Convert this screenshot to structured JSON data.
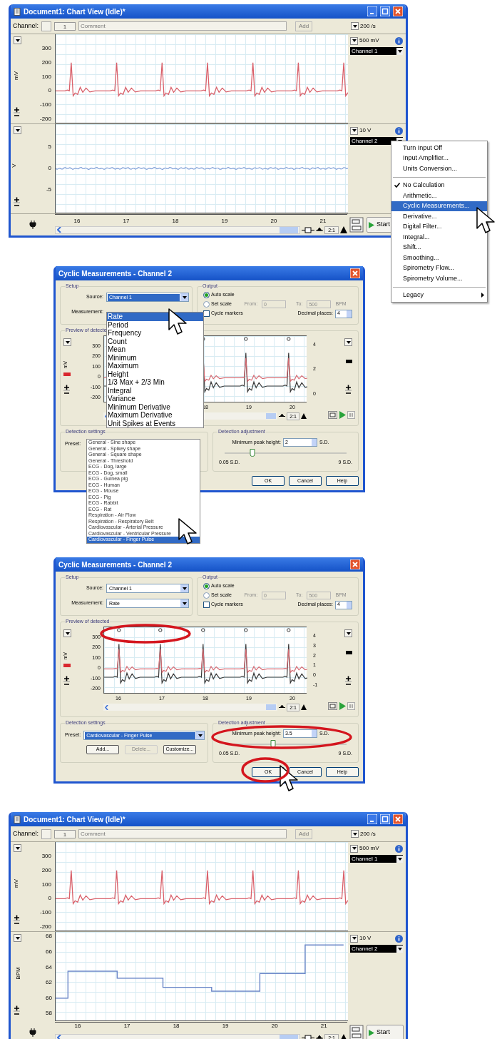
{
  "chart_view_before": {
    "title": "Document1: Chart View (Idle)*",
    "channel_label": "Channel:",
    "channel_number": "1",
    "comment_placeholder": "Comment",
    "add_button": {
      "label": "Add",
      "disabled": true
    },
    "sample_rate": "200 /s",
    "channels": [
      {
        "kind": "ecg",
        "range": "500 mV",
        "name": "Channel 1",
        "unit": "mV",
        "color": "#d9606a",
        "yticks": [
          "300",
          "200",
          "100",
          "0",
          "-100",
          "-200"
        ]
      },
      {
        "kind": "flat",
        "range": "10 V",
        "name": "Channel 2",
        "unit": "V",
        "color": "#7f9fd8",
        "yticks": [
          "5",
          "0",
          "-5"
        ]
      }
    ],
    "xticks": [
      "16",
      "17",
      "18",
      "19",
      "20",
      "21"
    ],
    "zoom": "2:1",
    "start_button": "Start"
  },
  "context_menu": {
    "items": [
      {
        "kind": "item",
        "label": "Turn Input Off",
        "checked": false,
        "selected": false
      },
      {
        "kind": "item",
        "label": "Input Amplifier...",
        "checked": false,
        "selected": false
      },
      {
        "kind": "item",
        "label": "Units Conversion...",
        "checked": false,
        "selected": false
      },
      {
        "kind": "separator"
      },
      {
        "kind": "item",
        "label": "No Calculation",
        "checked": true,
        "selected": false
      },
      {
        "kind": "item",
        "label": "Arithmetic...",
        "checked": false,
        "selected": false
      },
      {
        "kind": "item",
        "label": "Cyclic Measurements...",
        "checked": false,
        "selected": true
      },
      {
        "kind": "item",
        "label": "Derivative...",
        "checked": false,
        "selected": false
      },
      {
        "kind": "item",
        "label": "Digital Filter...",
        "checked": false,
        "selected": false
      },
      {
        "kind": "item",
        "label": "Integral...",
        "checked": false,
        "selected": false
      },
      {
        "kind": "item",
        "label": "Shift...",
        "checked": false,
        "selected": false
      },
      {
        "kind": "item",
        "label": "Smoothing...",
        "checked": false,
        "selected": false
      },
      {
        "kind": "item",
        "label": "Spirometry Flow...",
        "checked": false,
        "selected": false
      },
      {
        "kind": "item",
        "label": "Spirometry Volume...",
        "checked": false,
        "selected": false
      },
      {
        "kind": "separator"
      },
      {
        "kind": "submenu",
        "label": "Legacy",
        "checked": false,
        "selected": false
      }
    ]
  },
  "dialog_choosing": {
    "title": "Cyclic Measurements - Channel 2",
    "setup_label": "Setup",
    "source_label": "Source:",
    "source_value": "Channel 1",
    "source_highlighted": true,
    "measurement_label": "Measurement:",
    "measurement_list": [
      {
        "label": "Rate",
        "selected": true
      },
      {
        "label": "Period",
        "selected": false
      },
      {
        "label": "Frequency",
        "selected": false
      },
      {
        "label": "Count",
        "selected": false
      },
      {
        "label": "Mean",
        "selected": false
      },
      {
        "label": "Minimum",
        "selected": false
      },
      {
        "label": "Maximum",
        "selected": false
      },
      {
        "label": "Height",
        "selected": false
      },
      {
        "label": "1/3 Max + 2/3 Min",
        "selected": false
      },
      {
        "label": "Integral",
        "selected": false
      },
      {
        "label": "Variance",
        "selected": false
      },
      {
        "label": "Minimum Derivative",
        "selected": false
      },
      {
        "label": "Maximum Derivative",
        "selected": false
      },
      {
        "label": "Unit Spikes at Events",
        "selected": false
      }
    ],
    "output_label": "Output",
    "auto_scale": {
      "label": "Auto scale",
      "selected": true
    },
    "set_scale": {
      "label": "Set scale",
      "selected": false
    },
    "from": {
      "label": "From:",
      "value": "0"
    },
    "to": {
      "label": "To:",
      "value": "500",
      "unit": "BPM"
    },
    "cycle_markers": {
      "label": "Cycle markers",
      "checked": false
    },
    "decimal_label": "Decimal places:",
    "decimal_value": "4",
    "preview": {
      "label": "Preview of detecte",
      "unit": "mV",
      "left_yticks": [
        "300",
        "200",
        "100",
        "0",
        "-100",
        "-200"
      ],
      "right_yticks": [
        "4",
        "2",
        "0"
      ],
      "xticks": [
        "18",
        "19",
        "20"
      ],
      "zoom": "2:1"
    },
    "detection_settings_label": "Preset:",
    "detection_group_label": "Detection settings",
    "preset_list": [
      {
        "label": "General - Sine shape",
        "selected": false
      },
      {
        "label": "General - Spikey shape",
        "selected": false
      },
      {
        "label": "General - Square shape",
        "selected": false
      },
      {
        "label": "General - Threshold",
        "selected": false
      },
      {
        "label": "ECG - Dog, large",
        "selected": false
      },
      {
        "label": "ECG - Dog, small",
        "selected": false
      },
      {
        "label": "ECG - Guinea pig",
        "selected": false
      },
      {
        "label": "ECG - Human",
        "selected": false
      },
      {
        "label": "ECG - Mouse",
        "selected": false
      },
      {
        "label": "ECG - Pig",
        "selected": false
      },
      {
        "label": "ECG - Rabbit",
        "selected": false
      },
      {
        "label": "ECG - Rat",
        "selected": false
      },
      {
        "label": "Respiration - Air Flow",
        "selected": false
      },
      {
        "label": "Respiration - Respiratory Belt",
        "selected": false
      },
      {
        "label": "Cardiovascular - Arterial Pressure",
        "selected": false
      },
      {
        "label": "Cardiovascular - Ventricular Pressure",
        "selected": false
      },
      {
        "label": "Cardiovascular - Finger Pulse",
        "selected": true
      }
    ],
    "adjustment_label": "Detection adjustment",
    "min_peak_label": "Minimum peak height:",
    "min_peak_value": "2",
    "min_peak_unit": "S.D.",
    "slider": {
      "level": 0.23,
      "min_label": "0.05 S.D.",
      "max_label": "9 S.D."
    },
    "buttons": [
      "OK",
      "Cancel",
      "Help"
    ]
  },
  "dialog_set": {
    "title": "Cyclic Measurements - Channel 2",
    "setup_label": "Setup",
    "source_label": "Source:",
    "source_value": "Channel 1",
    "source_highlighted": false,
    "measurement_label": "Measurement:",
    "measurement_value": "Rate",
    "output_label": "Output",
    "auto_scale": {
      "label": "Auto scale",
      "selected": true
    },
    "set_scale": {
      "label": "Set scale",
      "selected": false
    },
    "from": {
      "label": "From:",
      "value": "0"
    },
    "to": {
      "label": "To:",
      "value": "500",
      "unit": "BPM"
    },
    "cycle_markers": {
      "label": "Cycle markers",
      "checked": false
    },
    "decimal_label": "Decimal places:",
    "decimal_value": "4",
    "preview": {
      "label": "Preview of detected",
      "unit": "mV",
      "left_yticks": [
        "300",
        "200",
        "100",
        "0",
        "-100",
        "-200"
      ],
      "right_yticks": [
        "4",
        "3",
        "2",
        "1",
        "0",
        "-1"
      ],
      "xticks": [
        "16",
        "17",
        "18",
        "19",
        "20"
      ],
      "zoom": "2:1"
    },
    "detection_settings_label": "Preset:",
    "detection_group_label": "Detection settings",
    "preset_value": "Cardiovascular - Finger Pulse",
    "preset_highlighted": true,
    "preset_buttons": [
      {
        "label": "Add...",
        "disabled": false
      },
      {
        "label": "Delete...",
        "disabled": true
      },
      {
        "label": "Customize...",
        "disabled": false
      }
    ],
    "adjustment_label": "Detection adjustment",
    "min_peak_label": "Minimum peak height:",
    "min_peak_value": "3.5",
    "min_peak_unit": "S.D.",
    "slider": {
      "level": 0.4,
      "min_label": "0.05 S.D.",
      "max_label": "9 S.D."
    },
    "buttons": [
      "OK",
      "Cancel",
      "Help"
    ]
  },
  "chart_view_after": {
    "title": "Document1: Chart View (Idle)*",
    "channel_label": "Channel:",
    "channel_number": "1",
    "comment_placeholder": "Comment",
    "add_button": {
      "label": "Add",
      "disabled": true
    },
    "sample_rate": "200 /s",
    "channels": [
      {
        "kind": "ecg",
        "range": "500 mV",
        "name": "Channel 1",
        "unit": "mV",
        "color": "#d9606a",
        "yticks": [
          "300",
          "200",
          "100",
          "0",
          "-100",
          "-200"
        ]
      },
      {
        "kind": "chart",
        "range": "10 V",
        "name": "Channel 2",
        "unit": "BPM",
        "chart_data": {
          "type": "line",
          "xlim": [
            15.55,
            21.49
          ],
          "ylim": [
            57.1,
            68.6
          ],
          "xticks": [
            16,
            17,
            18,
            19,
            20,
            21
          ],
          "yticks": [
            68,
            66,
            64,
            62,
            60,
            58
          ],
          "x": [
            15.55,
            15.8,
            15.8,
            16.8,
            16.8,
            17.73,
            17.73,
            18.72,
            18.72,
            19.7,
            19.7,
            20.62,
            20.62,
            21.4
          ],
          "series": [
            {
              "color": "#6a86c8",
              "values": [
                60,
                60,
                63.5,
                63.5,
                62.6,
                62.6,
                61.4,
                61.4,
                60.9,
                60.9,
                63.2,
                63.2,
                66.9,
                66.9
              ]
            }
          ]
        }
      }
    ],
    "zoom": "2:1",
    "start_button": "Start"
  }
}
